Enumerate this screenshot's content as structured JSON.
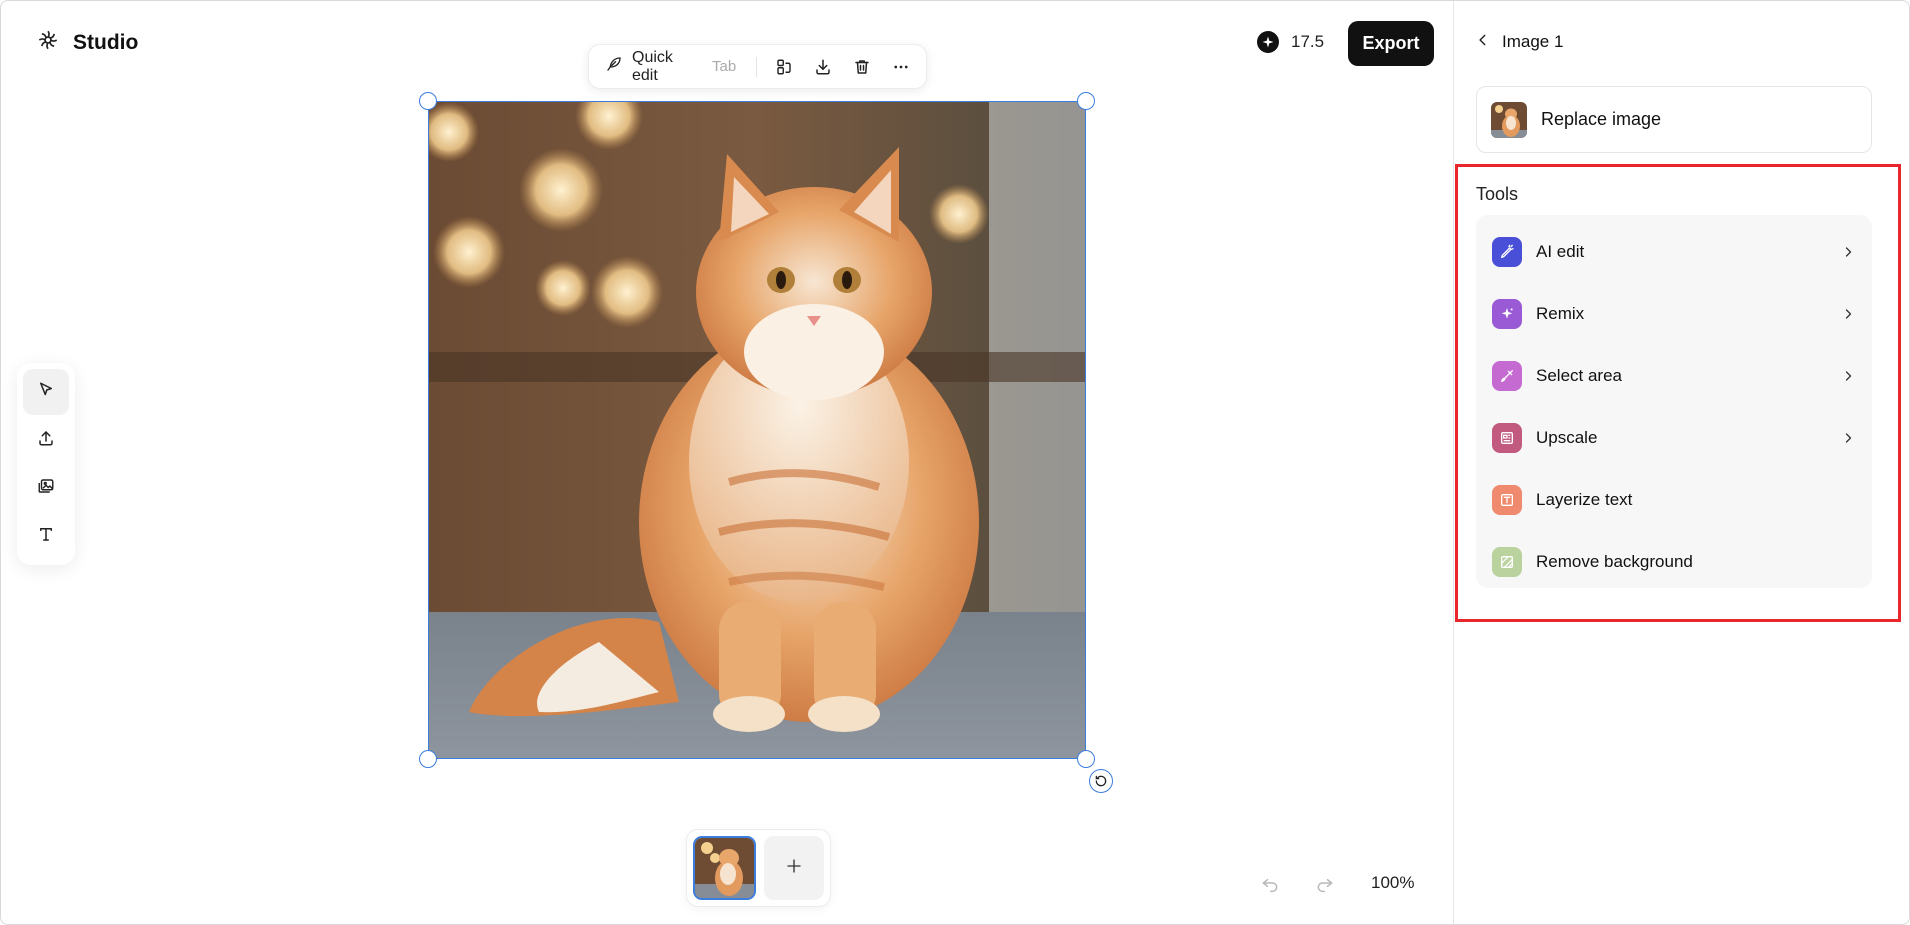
{
  "header": {
    "brand": "Studio",
    "credits": "17.5",
    "export_label": "Export"
  },
  "quick_edit": {
    "label": "Quick edit",
    "hint": "Tab",
    "icons": [
      "crop-ratio-icon",
      "download-icon",
      "trash-icon",
      "more-icon"
    ]
  },
  "left_tools": [
    {
      "name": "select-tool",
      "icon": "cursor-icon",
      "active": true
    },
    {
      "name": "upload-tool",
      "icon": "upload-icon",
      "active": false
    },
    {
      "name": "image-tool",
      "icon": "images-icon",
      "active": false
    },
    {
      "name": "text-tool",
      "icon": "text-icon",
      "active": false
    }
  ],
  "bottom": {
    "zoom": "100%"
  },
  "right_panel": {
    "title": "Image 1",
    "replace_label": "Replace image",
    "tools_heading": "Tools",
    "tools": [
      {
        "label": "AI edit",
        "color": "#4a4fd8",
        "chevron": true
      },
      {
        "label": "Remix",
        "color": "#9a5ad6",
        "chevron": true
      },
      {
        "label": "Select area",
        "color": "#c46ad0",
        "chevron": true
      },
      {
        "label": "Upscale",
        "color": "#c2597f",
        "chevron": true
      },
      {
        "label": "Layerize text",
        "color": "#ef8a6f",
        "chevron": false
      },
      {
        "label": "Remove background",
        "color": "#b9d29e",
        "chevron": false
      }
    ]
  },
  "colors": {
    "selection": "#3b7ddd",
    "highlight": "#e8262b"
  }
}
